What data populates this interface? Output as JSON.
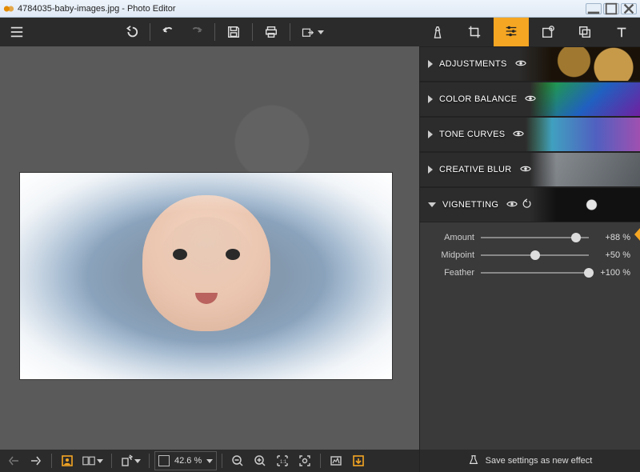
{
  "window": {
    "title": "4784035-baby-images.jpg - Photo Editor"
  },
  "toolTabs": {
    "effects": "Effects",
    "crop": "Crop",
    "adjust": "Adjust",
    "retouch": "Retouch",
    "overlay": "Overlay",
    "text": "Text"
  },
  "sections": {
    "adjustments": {
      "label": "ADJUSTMENTS",
      "expanded": false
    },
    "colorBalance": {
      "label": "COLOR BALANCE",
      "expanded": false
    },
    "toneCurves": {
      "label": "TONE CURVES",
      "expanded": false
    },
    "creativeBlur": {
      "label": "CREATIVE BLUR",
      "expanded": false
    },
    "vignetting": {
      "label": "VIGNETTING",
      "expanded": true,
      "sliders": {
        "amount": {
          "label": "Amount",
          "value": 88,
          "display": "+88 %"
        },
        "midpoint": {
          "label": "Midpoint",
          "value": 50,
          "display": "+50 %"
        },
        "feather": {
          "label": "Feather",
          "value": 100,
          "display": "+100 %"
        }
      }
    }
  },
  "zoom": {
    "value": "42.6 %"
  },
  "saveEffect": {
    "label": "Save settings as new effect"
  }
}
